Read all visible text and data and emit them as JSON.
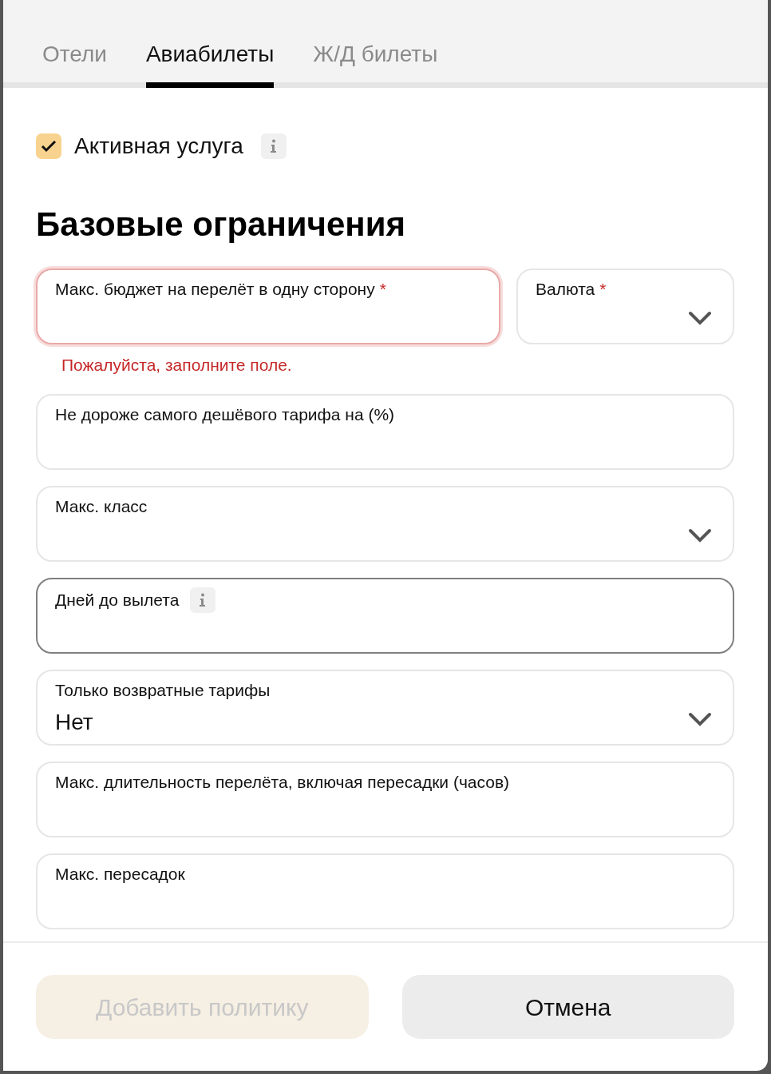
{
  "tabs": [
    {
      "label": "Отели",
      "selected": false
    },
    {
      "label": "Авиабилеты",
      "selected": true
    },
    {
      "label": "Ж/Д билеты",
      "selected": false
    }
  ],
  "active_service": {
    "label": "Активная услуга",
    "checked": true,
    "info": true
  },
  "section_title": "Базовые ограничения",
  "rows": [
    [
      {
        "label": "Макс. бюджет на перелёт в одну сторону",
        "kind": "input",
        "required_mark": "*",
        "error": "Пожалуйста, заполните поле.",
        "focused": false
      },
      {
        "label": "Валюта",
        "kind": "select",
        "required_mark": "*",
        "focused": false
      }
    ],
    [
      {
        "label": "Не дороже самого дешёвого тарифа на (%)",
        "kind": "input",
        "focused": false
      }
    ],
    [
      {
        "label": "Макс. класс",
        "kind": "select",
        "focused": false
      }
    ],
    [
      {
        "label": "Дней до вылета",
        "kind": "input",
        "focused": true,
        "info": true
      }
    ],
    [
      {
        "label": "Только возвратные тарифы",
        "kind": "select",
        "focused": false,
        "value": "Нет"
      }
    ],
    [
      {
        "label": "Макс. длительность перелёта, включая пересадки (часов)",
        "kind": "input",
        "focused": false
      }
    ],
    [
      {
        "label": "Макс. пересадок",
        "kind": "input",
        "focused": false
      }
    ]
  ],
  "buttons": [
    {
      "label": "Добавить политику",
      "kind": "primary",
      "disabled": true
    },
    {
      "label": "Отмена",
      "kind": "secondary"
    }
  ]
}
